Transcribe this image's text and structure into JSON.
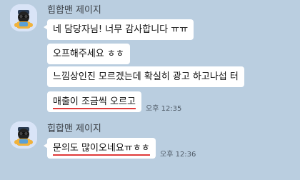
{
  "chat": {
    "groups": [
      {
        "sender": "힙합맨 제이지",
        "messages": [
          {
            "text": "네 담당자님! 너무 감사합니다 ㅠㅠ"
          },
          {
            "text": "오프해주세요 ㅎㅎ"
          },
          {
            "text": "느낌상인진 모르겠는데 확실히 광고 하고나섭 터"
          },
          {
            "text": "매출이 조금씩 오르고",
            "time": "오후 12:35"
          }
        ]
      },
      {
        "sender": "힙합맨 제이지",
        "messages": [
          {
            "text": "문의도 많이오네요ㅠㅎㅎ",
            "time": "오후 12:36"
          }
        ]
      }
    ]
  },
  "colors": {
    "background": "#bacee0",
    "bubble": "#ffffff",
    "underline": "#e03a3a",
    "avatar_bg": "#d9e4f7"
  },
  "icons": {
    "avatar": "cartoon-character-with-sunglasses-and-cap"
  }
}
